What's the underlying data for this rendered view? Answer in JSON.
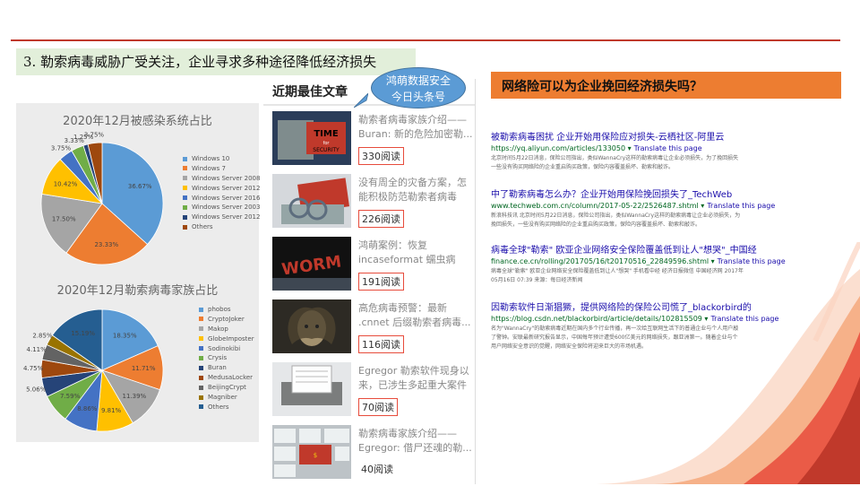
{
  "heading": "3. 勒索病毒威胁广受关注，企业寻求多种途径降低经济损失",
  "charts": {
    "infected_systems": {
      "title": "2020年12月被感染系统占比",
      "slice_labels": [
        "36.67%",
        "23.33%",
        "17.50%",
        "10.42%",
        "3.75%",
        "3.33%",
        "1.25%",
        "3.75%"
      ],
      "legend": [
        "Windows 10",
        "Windows 7",
        "Windows Server 2008",
        "Windows Server 2012",
        "Windows Server 2016",
        "Windows Server 2003",
        "Windows Server 2012",
        "Others"
      ]
    },
    "ransomware_families": {
      "title": "2020年12月勒索病毒家族占比",
      "slice_labels": [
        "18.35%",
        "11.71%",
        "11.39%",
        "9.81%",
        "8.86%",
        "7.59%",
        "5.06%",
        "4.75%",
        "4.11%",
        "2.85%",
        "15.19%"
      ],
      "legend": [
        "phobos",
        "CryptoJoker",
        "Makop",
        "GlobeImposter",
        "Sodinokibi",
        "Crysis",
        "Buran",
        "MedusaLocker",
        "BeijingCrypt",
        "Magniber",
        "Others"
      ]
    }
  },
  "chart_data": [
    {
      "type": "pie",
      "title": "2020年12月被感染系统占比",
      "categories": [
        "Windows 10",
        "Windows 7",
        "Windows Server 2008",
        "Windows Server 2012",
        "Windows Server 2016",
        "Windows Server 2003",
        "Windows Server 2012",
        "Others"
      ],
      "values": [
        36.67,
        23.33,
        17.5,
        10.42,
        3.75,
        3.33,
        1.25,
        3.75
      ],
      "colors": [
        "#5b9bd5",
        "#ed7d31",
        "#a5a5a5",
        "#ffc000",
        "#4472c4",
        "#70ad47",
        "#264478",
        "#9e480e"
      ],
      "legend_position": "right"
    },
    {
      "type": "pie",
      "title": "2020年12月勒索病毒家族占比",
      "categories": [
        "phobos",
        "CryptoJoker",
        "Makop",
        "GlobeImposter",
        "Sodinokibi",
        "Crysis",
        "Buran",
        "MedusaLocker",
        "BeijingCrypt",
        "Magniber",
        "Others"
      ],
      "values": [
        18.35,
        11.71,
        11.39,
        9.81,
        8.86,
        7.59,
        5.06,
        4.75,
        4.11,
        2.85,
        15.19
      ],
      "colors": [
        "#5b9bd5",
        "#ed7d31",
        "#a5a5a5",
        "#ffc000",
        "#4472c4",
        "#70ad47",
        "#264478",
        "#9e480e",
        "#636363",
        "#997300",
        "#255e91"
      ],
      "legend_position": "right"
    }
  ],
  "mid": {
    "title": "近期最佳文章",
    "bubble": [
      "鸿萌数据安全",
      "今日头条号"
    ],
    "articles": [
      {
        "title": "勒索者病毒家族介绍——Buran: 新的危险加密勒...",
        "reads": "330阅读",
        "boxed": true,
        "thumb": "time-for-security"
      },
      {
        "title": "没有周全的灾备方案，怎能积极防范勒索者病毒",
        "reads": "226阅读",
        "boxed": true,
        "thumb": "handcuffs-laptop"
      },
      {
        "title": "鸿萌案例：恢复 incaseformat 蠕虫病毒...",
        "reads": "191阅读",
        "boxed": true,
        "thumb": "worm"
      },
      {
        "title": "高危病毒预警：最新 .cnnet 后缀勒索者病毒...",
        "reads": "116阅读",
        "boxed": true,
        "thumb": "medusa"
      },
      {
        "title": "Egregor 勒索软件现身以来，已涉生多起重大案件",
        "reads": "70阅读",
        "boxed": true,
        "thumb": "printer"
      },
      {
        "title": "勒索病毒家族介绍——Egregor: 借尸还魂的勒...",
        "reads": "40阅读",
        "boxed": false,
        "thumb": "ransomware-key"
      }
    ]
  },
  "right": {
    "question": "网络险可以为企业挽回经济损失吗？",
    "translate_label": "Translate this page",
    "results": [
      {
        "title": "被勒索病毒困扰 企业开始用保险应对损失-云栖社区-阿里云",
        "url": "https://yq.aliyun.com/articles/133050",
        "snippet1": "北京时间5月22日消息，保险公司指出，类似WannaCry这样的勒索病毒让企业必须损失，为了挽回损失",
        "snippet2": "一些没有购买网络险的企业重启购买政策，保险内容覆盖损坏、勒索和敲诈。"
      },
      {
        "title": "中了勒索病毒怎么办？企业开始用保险挽回损失了_TechWeb",
        "url": "www.techweb.com.cn/column/2017-05-22/2526487.shtml",
        "snippet1": "新浪科技讯 北京时间5月22日消息，保险公司指出，类似WannaCry这样的勒索病毒让企业必须损失，为",
        "snippet2": "挽回损失，一些没有购买网络险的企业重启购买政策，保险内容覆盖损坏、勒索和敲诈。"
      },
      {
        "title": "病毒全球\"勒索\" 欧亚企业网络安全保险覆盖低到让人\"想哭\"_中国经",
        "url": "finance.ce.cn/rolling/201705/16/t20170516_22849596.shtml",
        "snippet1": "病毒全球\"勒索\" 欧亚企业网络安全保险覆盖低到让人\"想哭\" 手机看中经 经济日报微信 中国经济网 2017年",
        "snippet2": "05月16日 07:39 来源：每日经济新闻"
      },
      {
        "title": "因勒索软件日渐猖獗，提供网络险的保险公司慌了_blackorbird的",
        "url": "https://blog.csdn.net/blackorbird/article/details/102815509",
        "snippet1": "名为\"WannaCry\"的勒索病毒近期在国内多个行业传播，再一次给互联网生活下的普通企业与个人用户敲",
        "snippet2": "了警钟。安联最新研究报告显示，中国每年预计遭受600亿美元的网络损失，跟亚洲第一。随着企业与个",
        "snippet3": "用户网络安全意识的觉醒，网络安全保险将迎来巨大的市场机遇。"
      }
    ]
  }
}
